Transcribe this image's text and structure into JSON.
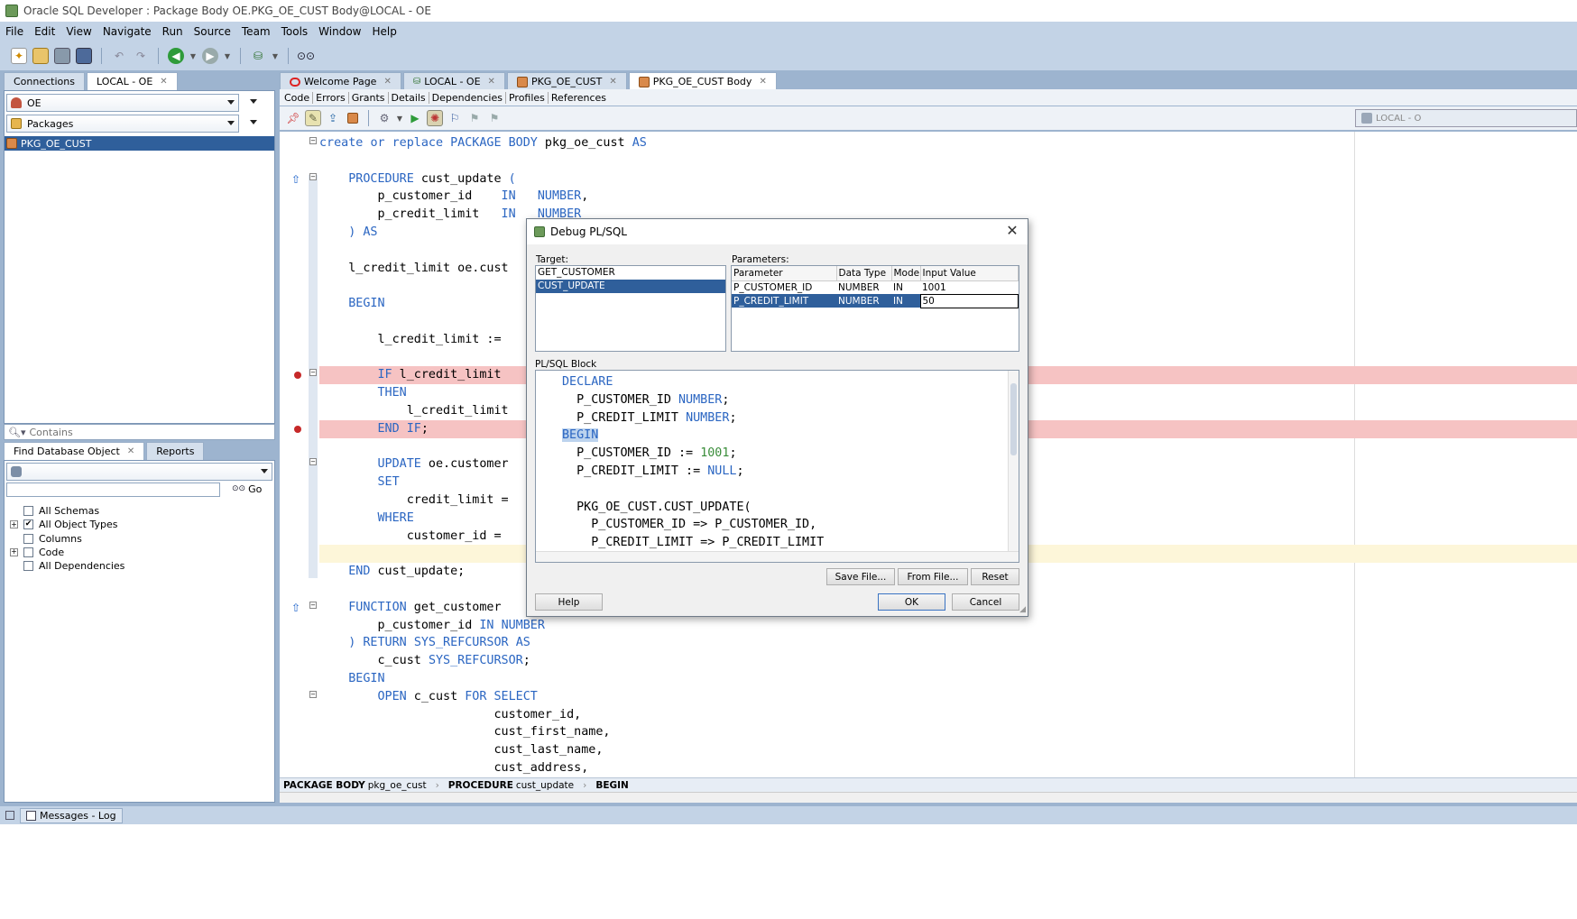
{
  "window": {
    "title": "Oracle SQL Developer : Package Body OE.PKG_OE_CUST Body@LOCAL - OE"
  },
  "menu": [
    "File",
    "Edit",
    "View",
    "Navigate",
    "Run",
    "Source",
    "Team",
    "Tools",
    "Window",
    "Help"
  ],
  "connections_panel": {
    "tabs": [
      "Connections",
      "LOCAL - OE"
    ],
    "schema": "OE",
    "object_type": "Packages",
    "items": [
      "PKG_OE_CUST"
    ],
    "filter_placeholder": "Contains"
  },
  "find_panel": {
    "tabs": [
      "Find Database Object",
      "Reports"
    ],
    "go_label": "Go",
    "options": [
      {
        "label": "All Schemas",
        "checked": false,
        "expandable": false
      },
      {
        "label": "All Object Types",
        "checked": true,
        "expandable": true
      },
      {
        "label": "Columns",
        "checked": false,
        "expandable": false
      },
      {
        "label": "Code",
        "checked": false,
        "expandable": true
      },
      {
        "label": "All Dependencies",
        "checked": false,
        "expandable": false
      }
    ]
  },
  "editor": {
    "tabs": [
      "Welcome Page",
      "LOCAL - OE",
      "PKG_OE_CUST",
      "PKG_OE_CUST Body"
    ],
    "subtabs": [
      "Code",
      "Errors",
      "Grants",
      "Details",
      "Dependencies",
      "Profiles",
      "References"
    ],
    "connection_selector": "LOCAL - O",
    "lines": [
      "create or replace PACKAGE BODY pkg_oe_cust AS",
      "",
      "    PROCEDURE cust_update (",
      "        p_customer_id    IN   NUMBER,",
      "        p_credit_limit   IN   NUMBER",
      "    ) AS",
      "",
      "    l_credit_limit oe.cust",
      "",
      "    BEGIN",
      "",
      "        l_credit_limit :=",
      "",
      "        IF l_credit_limit",
      "        THEN",
      "            l_credit_limit",
      "        END IF;",
      "",
      "        UPDATE oe.customer",
      "        SET",
      "            credit_limit =",
      "        WHERE",
      "            customer_id =",
      "",
      "    END cust_update;",
      "",
      "    FUNCTION get_customer",
      "        p_customer_id IN NUMBER",
      "    ) RETURN SYS_REFCURSOR AS",
      "        c_cust SYS_REFCURSOR;",
      "    BEGIN",
      "        OPEN c_cust FOR SELECT",
      "                        customer_id,",
      "                        cust_first_name,",
      "                        cust_last_name,",
      "                        cust_address,"
    ],
    "breadcrumb": [
      {
        "kind": "PACKAGE BODY",
        "name": "pkg_oe_cust"
      },
      {
        "kind": "PROCEDURE",
        "name": "cust_update"
      },
      {
        "kind": "BEGIN",
        "name": ""
      }
    ]
  },
  "status_bar": {
    "label": "Messages - Log"
  },
  "dialog": {
    "title": "Debug PL/SQL",
    "target_label": "Target:",
    "targets": [
      "GET_CUSTOMER",
      "CUST_UPDATE"
    ],
    "parameters_label": "Parameters:",
    "param_columns": [
      "Parameter",
      "Data Type",
      "Mode",
      "Input Value"
    ],
    "params": [
      {
        "name": "P_CUSTOMER_ID",
        "type": "NUMBER",
        "mode": "IN",
        "value": "1001"
      },
      {
        "name": "P_CREDIT_LIMIT",
        "type": "NUMBER",
        "mode": "IN",
        "value": "50"
      }
    ],
    "block_label": "PL/SQL Block",
    "block_lines": [
      "DECLARE",
      "  P_CUSTOMER_ID NUMBER;",
      "  P_CREDIT_LIMIT NUMBER;",
      "BEGIN",
      "  P_CUSTOMER_ID := 1001;",
      "  P_CREDIT_LIMIT := NULL;",
      "",
      "  PKG_OE_CUST.CUST_UPDATE(",
      "    P_CUSTOMER_ID => P_CUSTOMER_ID,",
      "    P_CREDIT_LIMIT => P_CREDIT_LIMIT"
    ],
    "buttons": {
      "save_file": "Save File...",
      "from_file": "From File...",
      "reset": "Reset",
      "help": "Help",
      "ok": "OK",
      "cancel": "Cancel"
    }
  },
  "colors": {
    "keyword": "#2b66c2",
    "breakpoint_line": "#f6c3c3",
    "selection": "#2f5f9b",
    "chrome": "#c3d3e6"
  }
}
